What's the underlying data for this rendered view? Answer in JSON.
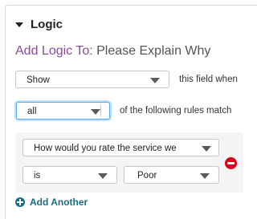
{
  "section": {
    "title": "Logic",
    "icon": "collapse-triangle-icon"
  },
  "logic_heading": {
    "prefix": "Add Logic To:",
    "target": "Please Explain Why"
  },
  "action_select": {
    "value": "Show",
    "suffix": "this field when"
  },
  "match_select": {
    "value": "all",
    "suffix": "of the following rules match"
  },
  "rule": {
    "field_select": "How would you rate the service we",
    "operator_select": "is",
    "value_select": "Poor",
    "remove_icon": "remove-circle-icon"
  },
  "add_another": {
    "label": "Add Another",
    "icon": "plus-circle-icon"
  },
  "colors": {
    "title_prefix": "#8a4a9e",
    "link": "#1b6b82",
    "remove": "#d9001b",
    "focus": "#5aa9e6"
  }
}
